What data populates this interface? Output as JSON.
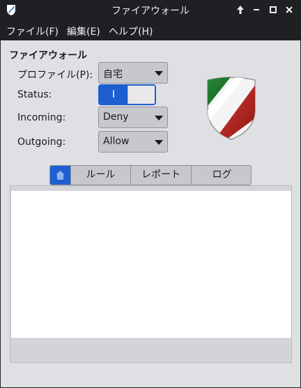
{
  "window": {
    "title": "ファイアウォール"
  },
  "menu": {
    "file": "ファイル(F)",
    "edit": "編集(E)",
    "help": "ヘルプ(H)"
  },
  "section_title": "ファイアウォール",
  "profile": {
    "label": "プロファイル(P):",
    "value": "自宅"
  },
  "status": {
    "label": "Status:",
    "toggle_on_text": "I",
    "state": "on"
  },
  "incoming": {
    "label": "Incoming:",
    "value": "Deny"
  },
  "outgoing": {
    "label": "Outgoing:",
    "value": "Allow"
  },
  "tabs": [
    {
      "label": "",
      "icon": "home-icon",
      "active": true
    },
    {
      "label": "ルール",
      "active": false
    },
    {
      "label": "レポート",
      "active": false
    },
    {
      "label": "ログ",
      "active": false
    }
  ],
  "colors": {
    "accent": "#1d5fd1",
    "titlebar": "#1e2023",
    "background": "#dfe0e4"
  }
}
